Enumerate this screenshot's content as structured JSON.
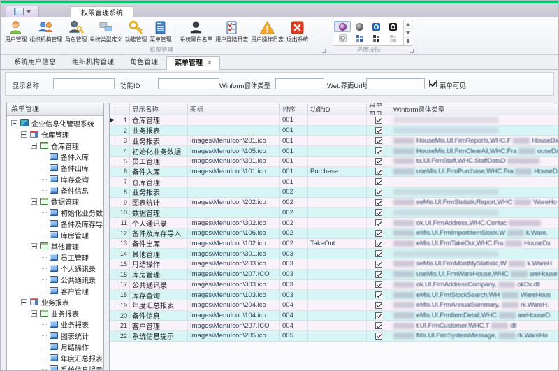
{
  "colors": {
    "accent_green": "#00c66a",
    "titlebar": "#cbcad6",
    "row_alt_pink": "#f9f2f8",
    "row_alt_cyan": "#d7f5f5",
    "exit_red": "#d93c20"
  },
  "ribbon": {
    "tab": "权限管理系统",
    "group1": {
      "label": "权限管理",
      "buttons": [
        {
          "label": "用户管理",
          "icon": "i-user",
          "icon_name": "user-management-icon"
        },
        {
          "label": "组织机构管理",
          "icon": "i-org",
          "icon_name": "organization-icon"
        },
        {
          "label": "角色管理",
          "icon": "i-role",
          "icon_name": "role-management-icon"
        },
        {
          "label": "系统类型定义",
          "icon": "i-systype",
          "icon_name": "system-type-icon"
        },
        {
          "label": "功能管理",
          "icon": "i-key",
          "icon_name": "function-management-icon"
        },
        {
          "label": "菜单管理",
          "icon": "i-menu",
          "icon_name": "menu-management-icon"
        },
        {
          "label": "系统黑白名单",
          "icon": "i-blacklist",
          "icon_name": "black-white-list-icon",
          "sep": true
        },
        {
          "label": "用户登陆日志",
          "icon": "i-loginlog",
          "icon_name": "login-log-icon"
        },
        {
          "label": "用户操作日志",
          "icon": "i-oplog",
          "icon_name": "operation-log-icon"
        },
        {
          "label": "退出系统",
          "icon": "i-exit",
          "icon_name": "exit-system-icon"
        }
      ]
    },
    "group2": {
      "label": "界面皮肤",
      "skins": [
        {
          "cls": "sk-purple",
          "selected": true
        },
        {
          "cls": "sk-dark"
        },
        {
          "cls": "sk-blue-o"
        },
        {
          "cls": "sk-black-o"
        },
        {
          "cls": "sk-white-o"
        },
        {
          "cls": "sk-blocks-blue"
        },
        {
          "cls": "sk-blocks-dark"
        },
        {
          "cls": "sk-blocks-pale"
        }
      ]
    }
  },
  "doc_tabs": [
    {
      "label": "系统用户信息"
    },
    {
      "label": "组织机构管理"
    },
    {
      "label": "角色管理"
    },
    {
      "label": "菜单管理",
      "active": true,
      "close": "×"
    }
  ],
  "filter": {
    "display_name_label": "显示名称",
    "display_name_value": "",
    "func_id_label": "功能ID",
    "func_id_value": "",
    "winform_label": "Winform窗体类型",
    "winform_value": "",
    "web_url_label": "Web界面Url地址",
    "web_url_value": "",
    "menu_visible_label": "菜单可见",
    "menu_visible_checked": true
  },
  "tree": {
    "header": "菜单管理",
    "nodes": [
      {
        "label": "企业信息化管理系统",
        "lv": "lv0",
        "kind": "root",
        "exp": true
      },
      {
        "label": "仓库管理",
        "lv": "lv1",
        "kind": "module",
        "exp": true
      },
      {
        "label": "仓库管理",
        "lv": "lv2",
        "kind": "folder",
        "exp": true
      },
      {
        "label": "备件入库",
        "lv": "lv3",
        "kind": "leaf"
      },
      {
        "label": "备件出库",
        "lv": "lv3",
        "kind": "leaf"
      },
      {
        "label": "库存查询",
        "lv": "lv3",
        "kind": "leaf"
      },
      {
        "label": "备件信息",
        "lv": "lv3",
        "kind": "leaf"
      },
      {
        "label": "数据管理",
        "lv": "lv2",
        "kind": "folder",
        "exp": true
      },
      {
        "label": "初始化业务数据",
        "lv": "lv3",
        "kind": "leaf"
      },
      {
        "label": "备件及库存导入",
        "lv": "lv3",
        "kind": "leaf"
      },
      {
        "label": "库房管理",
        "lv": "lv3",
        "kind": "leaf"
      },
      {
        "label": "其他管理",
        "lv": "lv2",
        "kind": "folder",
        "exp": true
      },
      {
        "label": "员工管理",
        "lv": "lv3",
        "kind": "leaf"
      },
      {
        "label": "个人通讯录",
        "lv": "lv3",
        "kind": "leaf"
      },
      {
        "label": "公共通讯录",
        "lv": "lv3",
        "kind": "leaf"
      },
      {
        "label": "客户管理",
        "lv": "lv3",
        "kind": "leaf"
      },
      {
        "label": "业务报表",
        "lv": "lv1",
        "kind": "module",
        "exp": true
      },
      {
        "label": "业务报表",
        "lv": "lv2",
        "kind": "folder",
        "exp": true
      },
      {
        "label": "业务报表",
        "lv": "lv3",
        "kind": "leaf"
      },
      {
        "label": "图表统计",
        "lv": "lv3",
        "kind": "leaf"
      },
      {
        "label": "月结操作",
        "lv": "lv3",
        "kind": "leaf"
      },
      {
        "label": "年度汇总报表",
        "lv": "lv3",
        "kind": "leaf"
      },
      {
        "label": "系统信息提示",
        "lv": "lv3",
        "kind": "leaf"
      }
    ]
  },
  "grid": {
    "columns": [
      "显示名称",
      "图标",
      "排序",
      "功能ID",
      "菜单可见",
      "Winform窗体类型"
    ],
    "rows": [
      {
        "num": "1",
        "name": "仓库管理",
        "icon": "",
        "order": "001",
        "func": "",
        "vis": true,
        "current": true,
        "maskonly": true
      },
      {
        "num": "2",
        "name": "业务报表",
        "icon": "",
        "order": "001",
        "func": "",
        "vis": true,
        "maskonly": true
      },
      {
        "num": "3",
        "name": "业务报表",
        "icon": "Images\\MenuIcon\\201.ico",
        "order": "001",
        "func": "",
        "vis": true,
        "wf1": "HouseMis.UI.FrmReports,WHC.F",
        "wf2": "HouseDx."
      },
      {
        "num": "4",
        "name": "初始化业务数据",
        "icon": "Images\\MenuIcon\\105.ico",
        "order": "001",
        "func": "",
        "vis": true,
        "wf1": "HouseMis.UI.FrmClearAll,WHC.Fra",
        "wf2": "ouseDx.d"
      },
      {
        "num": "5",
        "name": "员工管理",
        "icon": "Images\\MenuIcon\\301.ico",
        "order": "001",
        "func": "",
        "vis": true,
        "wf1": "ta.UI.FrmStaff,WHC.StaffDataD",
        "mC": true
      },
      {
        "num": "6",
        "name": "备件入库",
        "icon": "Images\\MenuIcon\\101.ico",
        "order": "001",
        "func": "Purchase",
        "vis": true,
        "wf1": "useMis.UI.FrmPurchase,WHC.Fra",
        "wf2": "HouseDx"
      },
      {
        "num": "7",
        "name": "仓库管理",
        "icon": "",
        "order": "001",
        "func": "",
        "vis": true
      },
      {
        "num": "8",
        "name": "业务报表",
        "icon": "",
        "order": "002",
        "func": "",
        "vis": true,
        "maskonly": true
      },
      {
        "num": "9",
        "name": "图表统计",
        "icon": "Images\\MenuIcon\\202.ico",
        "order": "002",
        "func": "",
        "vis": true,
        "wf1": "seMis.UI.FrmStatisticReport,WHC",
        "wf2": "WareHo"
      },
      {
        "num": "10",
        "name": "数据管理",
        "icon": "",
        "order": "002",
        "func": "",
        "vis": true,
        "maskonly": true
      },
      {
        "num": "11",
        "name": "个人通讯录",
        "icon": "Images\\MenuIcon\\302.ico",
        "order": "002",
        "func": "",
        "vis": true,
        "wf1": "ok.UI.FrmAddress,WHC.Contac",
        "mC": true
      },
      {
        "num": "12",
        "name": "备件及库存导入",
        "icon": "Images\\MenuIcon\\106.ico",
        "order": "002",
        "func": "",
        "vis": true,
        "wf1": "eMis.UI.FrmImportItemStock,W",
        "wf2": "k.Ware."
      },
      {
        "num": "13",
        "name": "备件出库",
        "icon": "Images\\MenuIcon\\102.ico",
        "order": "002",
        "func": "TakeOut",
        "vis": true,
        "wf1": "eMis.UI.FrmTakeOut,WHC.Fra",
        "wf2": "HouseDx"
      },
      {
        "num": "14",
        "name": "其他管理",
        "icon": "Images\\MenuIcon\\301.ico",
        "order": "003",
        "func": "",
        "vis": true,
        "maskonly": true
      },
      {
        "num": "15",
        "name": "月结操作",
        "icon": "Images\\MenuIcon\\203.ico",
        "order": "003",
        "func": "",
        "vis": true,
        "wf1": "seMis.UI.FrmMonthlyStatistic,W",
        "wf2": "k.WareH"
      },
      {
        "num": "16",
        "name": "库房管理",
        "icon": "Images\\MenuIcon\\207.ICO",
        "order": "003",
        "func": "",
        "vis": true,
        "wf1": "useMis.UI.FrmWareHouse,WHC",
        "wf2": "areHouse"
      },
      {
        "num": "17",
        "name": "公共通讯录",
        "icon": "Images\\MenuIcon\\303.ico",
        "order": "003",
        "func": "",
        "vis": true,
        "wf1": "ok.UI.FrmAddressCompany,",
        "wf2": "okDx.dll"
      },
      {
        "num": "18",
        "name": "库存查询",
        "icon": "Images\\MenuIcon\\103.ico",
        "order": "003",
        "func": "",
        "vis": true,
        "wf1": "eMis.UI.FrmStockSearch,WH",
        "wf2": "WareHous"
      },
      {
        "num": "19",
        "name": "年度汇总报表",
        "icon": "Images\\MenuIcon\\204.ico",
        "order": "004",
        "func": "",
        "vis": true,
        "wf1": "eMis.UI.FrmAnnualSummary,",
        "wf2": "rk.WareH."
      },
      {
        "num": "20",
        "name": "备件信息",
        "icon": "Images\\MenuIcon\\104.ico",
        "order": "004",
        "func": "",
        "vis": true,
        "wf1": "eMis.UI.FrmItemDetail,WHC",
        "wf2": "areHouseD"
      },
      {
        "num": "21",
        "name": "客户管理",
        "icon": "Images\\MenuIcon\\207.ICO",
        "order": "004",
        "func": "",
        "vis": true,
        "wf1": "t.UI.FrmCustomer,WHC.T",
        "wf2": "dll"
      },
      {
        "num": "22",
        "name": "系统信息提示",
        "icon": "Images\\MenuIcon\\205.ico",
        "order": "005",
        "func": "",
        "vis": true,
        "wf1": "Mis.UI.FrmSystemMessage,",
        "wf2": "rk.WareHo"
      }
    ]
  }
}
